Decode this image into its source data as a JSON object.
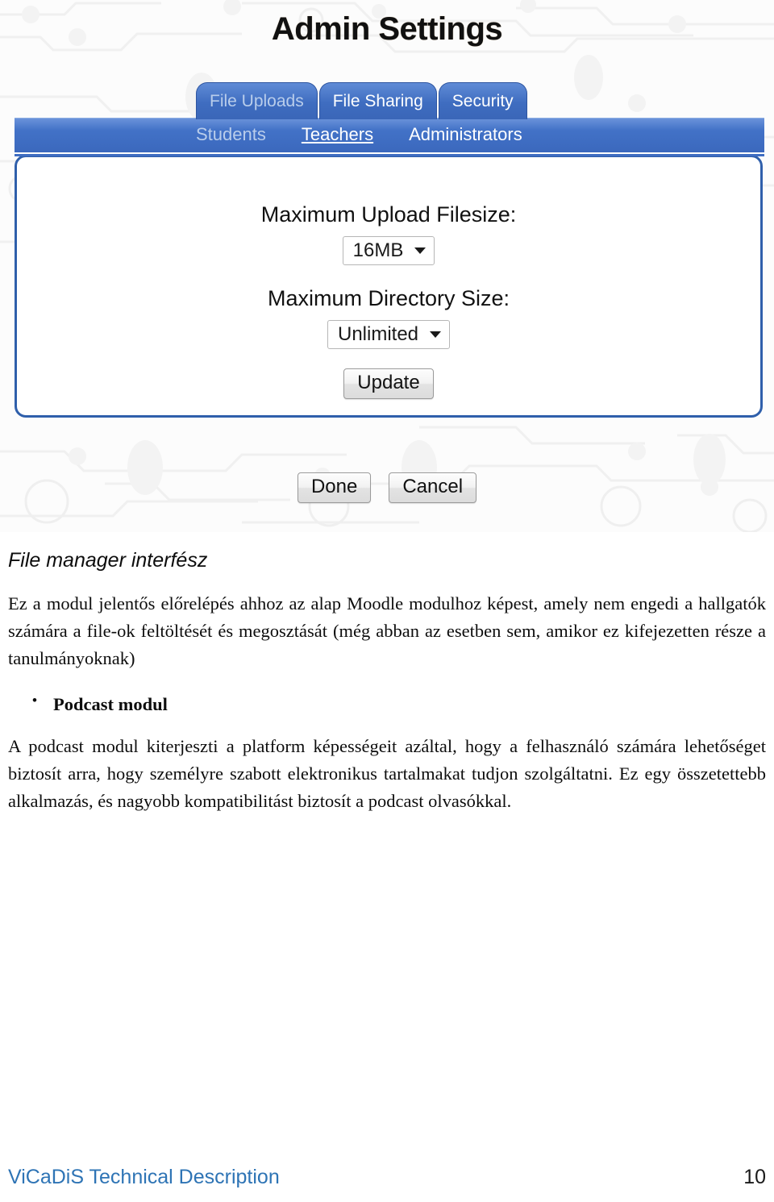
{
  "screenshot": {
    "app_title": "Admin Settings",
    "tabs": [
      {
        "label": "File Uploads",
        "active": false
      },
      {
        "label": "File Sharing",
        "active": true
      },
      {
        "label": "Security",
        "active": true
      }
    ],
    "subtabs": [
      {
        "label": "Students",
        "active": false,
        "underlined": false
      },
      {
        "label": "Teachers",
        "active": true,
        "underlined": true
      },
      {
        "label": "Administrators",
        "active": true,
        "underlined": false
      }
    ],
    "form": {
      "upload_label": "Maximum Upload Filesize:",
      "upload_value": "16MB",
      "directory_label": "Maximum Directory Size:",
      "directory_value": "Unlimited",
      "update_button": "Update"
    },
    "dialog_buttons": {
      "done": "Done",
      "cancel": "Cancel"
    },
    "colors": {
      "tab_blue": "#3f6dc0",
      "bar_blue": "#4272c7",
      "panel_border": "#2f5fab",
      "inactive_tab_text": "#b9cdeb"
    }
  },
  "document": {
    "section_heading": "File manager interfész",
    "paragraph_1": "Ez a modul jelentős előrelépés ahhoz az alap Moodle modulhoz képest, amely nem engedi a hallgatók számára a file-ok feltöltését és megosztását (még abban az esetben sem, amikor ez kifejezetten része a tanulmányoknak)",
    "bullets": [
      "Podcast modul"
    ],
    "paragraph_2": "A podcast modul kiterjeszti a platform képességeit azáltal, hogy a felhasználó számára lehetőséget biztosít arra, hogy személyre szabott elektronikus tartalmakat tudjon szolgáltatni. Ez egy összetettebb alkalmazás, és nagyobb kompatibilitást biztosít a podcast olvasókkal."
  },
  "footer": {
    "title": "ViCaDiS Technical Description",
    "page_number": "10"
  }
}
